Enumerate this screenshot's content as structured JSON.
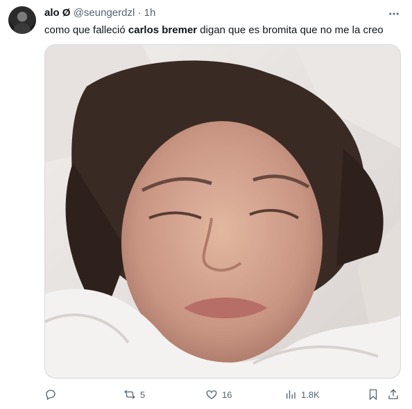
{
  "author": {
    "name": "alo Ø",
    "handle": "@seungerdzl",
    "separator": "·",
    "time": "1h",
    "avatar_icon": "avatar-icon"
  },
  "tweet": {
    "text_before": "como que falleció ",
    "text_bold": "carlos bremer",
    "text_after": " digan que es bromita que no me la creo"
  },
  "media": {
    "description_icon": "photo-of-person-in-bed"
  },
  "actions": {
    "reply": {
      "icon": "reply-icon",
      "count": ""
    },
    "retweet": {
      "icon": "retweet-icon",
      "count": "5"
    },
    "like": {
      "icon": "heart-icon",
      "count": "16"
    },
    "views": {
      "icon": "views-icon",
      "count": "1.8K"
    },
    "bookmark": {
      "icon": "bookmark-icon"
    },
    "share": {
      "icon": "share-icon"
    }
  },
  "colors": {
    "text": "#0f1419",
    "muted": "#536471",
    "border": "#cfd9de"
  }
}
